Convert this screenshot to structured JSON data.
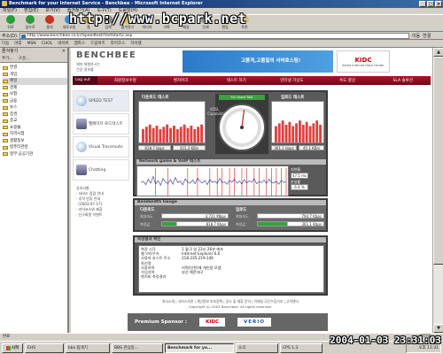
{
  "window": {
    "title": "Benchmark for your Internet Service - Benchbee - Microsoft Internet Explorer",
    "controls": [
      "_",
      "□",
      "×"
    ]
  },
  "menu": [
    "파일(F)",
    "편집(E)",
    "보기(V)",
    "즐겨찾기(A)",
    "도구(T)",
    "도움말(H)"
  ],
  "toolbar": [
    "뒤로",
    "앞으로",
    "중지",
    "새로고침",
    "홈",
    "검색",
    "즐겨찾기",
    "미디어",
    "기록",
    "메일",
    "인쇄",
    "편집",
    "토론"
  ],
  "watermark": "http://www.bcpark.net",
  "address": {
    "label": "주소(D)",
    "value": "http://www.benchbee.co.kr/Speedtest/TestStart2.asp",
    "go": "이동",
    "links": "연결"
  },
  "links": [
    "다음",
    "야후",
    "MSN",
    "CHOL",
    "네이버",
    "엠파스",
    "드림위즈",
    "라이코스",
    "하이텔"
  ],
  "favorites": {
    "title": "즐겨찾기",
    "add": "추가...",
    "organize": "구성...",
    "items": [
      "연결",
      "게임",
      "메일",
      "경제",
      "보험",
      "금융",
      "뉴스",
      "증권",
      "종교",
      "쇼핑몰",
      "자격시험",
      "생활정보",
      "컴퓨터관련",
      "정부·공공기관"
    ]
  },
  "site": {
    "logo": "BENCHBEE",
    "logo_sub": [
      "재미",
      "체험하시는",
      "건강",
      "정보를"
    ],
    "banner": "고품격,고품질의 서버호스팅!",
    "kidc": "KIDC",
    "kidc_sub": "Korea Internet Data Center",
    "nav": [
      "Log out",
      "회원정보수정",
      "벤치마크",
      "테스트 하기",
      "인터넷 가상도",
      "속도 향상",
      "SLA 솔루션"
    ],
    "left_nav": [
      "SPEED TEST",
      "웹페이지 로드테스트",
      "Visual Traceroute",
      "Chatting"
    ],
    "notice": [
      "공지사항",
      "· 서비스 점검 안내",
      "· 추석 연휴 안내",
      "· [2003-07-17]",
      "· 라이코스와 제휴",
      "· 신규회원 이벤트"
    ]
  },
  "speed": {
    "download_title": "다운로드 테스트",
    "upload_title": "업로드 테스트",
    "download_kbps": "818.7 kbps",
    "download_kBps": "101.3 KB/s",
    "upload_kbps": "361.1 kbps",
    "upload_kBps": "45.1 KB/s",
    "gauge_label": "VDSL Capability",
    "gauge_top": "For Home   Fast",
    "gauge_ticks": [
      "0",
      "25",
      "50",
      "75",
      "100"
    ],
    "gauge_value": 53,
    "dl_scale": [
      "784.0",
      "392.0"
    ],
    "ul_scale": [
      "361.0",
      "180.5"
    ]
  },
  "network": {
    "title": "Network game & VoIP 테스트",
    "jitter_label": "지연율",
    "jitter_value": "47.5 ms",
    "loss_label": "손실률",
    "loss_value": "6.4 %",
    "y_ticks": [
      "300",
      "200",
      "100",
      "0"
    ]
  },
  "bandwidth": {
    "title": "Bandwidth Gauge",
    "down_label": "다운로드",
    "up_label": "업로드",
    "rows": [
      {
        "name": "최대속도",
        "dl": "3,721 Mbps",
        "ul": "794.7 Kbps"
      },
      {
        "name": "측정값",
        "dl": "818.7 Kbps",
        "ul": "361.1 Kbps"
      }
    ]
  },
  "info": {
    "title": "측정결과 확인",
    "rows": [
      [
        "측정 시각",
        "1 월 3 일  23시 26분 에초"
      ],
      [
        "웹 브라우저",
        "Internet Explorer 6.0"
      ],
      [
        "사용자 호스트 주소",
        "218.235.219.146"
      ],
      [
        "회선명",
        ""
      ],
      [
        "사용지역",
        "지역(인천)에 개인용 모뎀"
      ],
      [
        "가입지역",
        "부산 해운대구"
      ],
      [
        "벤치비 측정결과",
        ""
      ]
    ]
  },
  "footer": {
    "links": [
      "회사소개",
      "서비스약관",
      "개인정보 보호정책",
      "광고 및 제휴 문의",
      "이메일 무단수집거부",
      "고객센터"
    ],
    "copy": "Copyright (c) 2003 Benchbee. All rights reserved."
  },
  "sponsor": {
    "label": "Premium Sponsor :",
    "a": "KIDC",
    "b": "VERIO"
  },
  "status": {
    "text": "완료",
    "zone": "인터넷"
  },
  "taskbar": {
    "start": "시작",
    "tasks": [
      "EHS",
      "bbs 탐색기",
      "BBS 관심등...",
      "Benchmark for yo...",
      "소식",
      "CPS 1.3"
    ],
    "clock": "오후 11:31"
  },
  "timestamp": "2004-01-03 23:31:03",
  "colors": {
    "nav": "#8a1022",
    "titlebar": "#0a246a",
    "accent": "#2b7bc8"
  },
  "net_chart": {
    "type": "line",
    "series": [
      {
        "values": [
          48,
          52,
          40,
          60,
          45,
          70,
          42,
          55,
          38,
          62,
          50,
          44,
          58,
          41,
          66,
          47,
          53,
          39,
          61,
          49,
          45,
          57,
          43,
          64,
          51,
          46,
          55,
          40,
          59,
          48,
          52,
          44,
          63,
          47,
          50,
          41,
          56,
          49,
          60,
          45,
          53,
          42,
          58,
          46,
          54,
          48,
          62,
          43,
          51,
          47,
          57,
          44,
          60,
          49,
          46,
          52,
          41,
          55,
          48,
          50
        ]
      }
    ],
    "spikes": [
      6,
      11,
      19,
      23,
      28,
      31,
      33,
      36,
      38,
      41,
      43,
      46,
      48,
      51,
      53,
      55,
      57,
      59
    ]
  }
}
